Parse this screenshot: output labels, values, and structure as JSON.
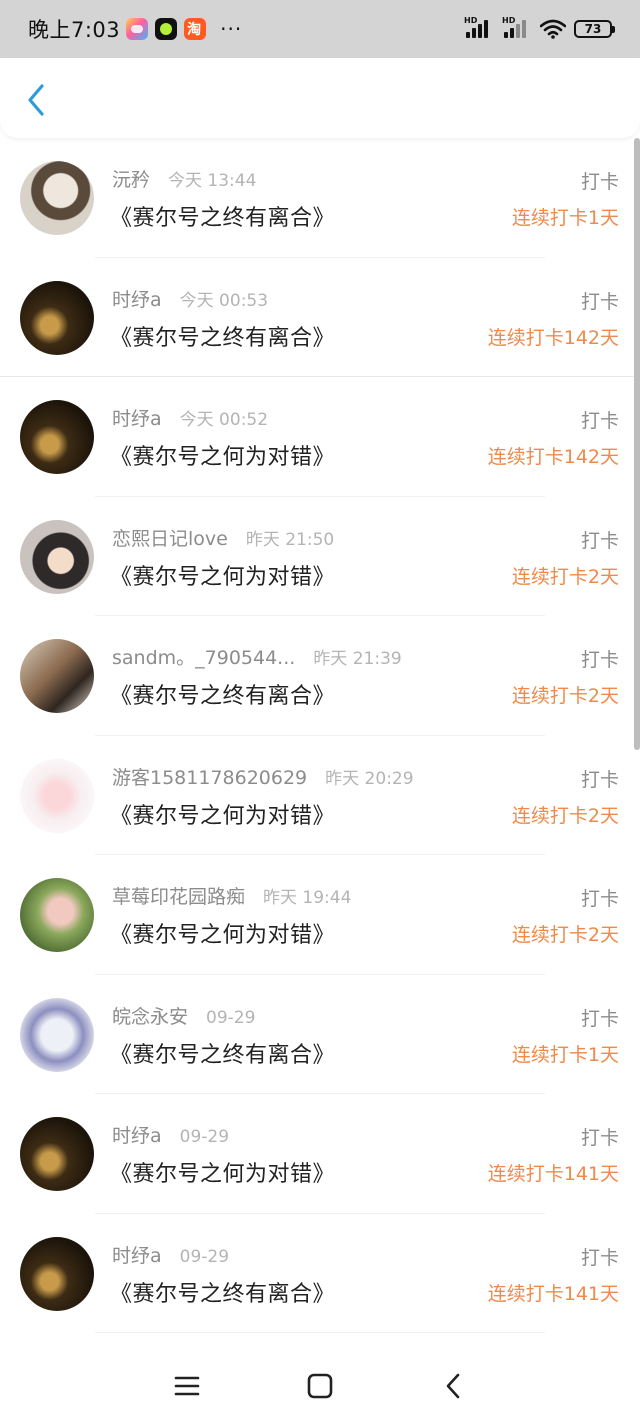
{
  "status_bar": {
    "time": "晚上7:03",
    "more": "···",
    "hd_label": "HD",
    "battery": "73",
    "icons": [
      "game-app-icon",
      "green-dot-app-icon",
      "taobao-app-icon",
      "signal-icon",
      "wifi-icon",
      "battery-icon"
    ]
  },
  "header": {
    "back_icon": "chevron-left-icon",
    "accent_color": "#2d9cdb"
  },
  "list": {
    "items": [
      {
        "user": "沅矜",
        "time": "今天 13:44",
        "title": "《赛尔号之终有离合》",
        "tag": "打卡",
        "streak": "连续打卡1天",
        "avatar": "anime-girl-avatar"
      },
      {
        "user": "时纾a",
        "time": "今天 00:53",
        "title": "《赛尔号之终有离合》",
        "tag": "打卡",
        "streak": "连续打卡142天",
        "avatar": "dark-photo-avatar"
      },
      {
        "user": "时纾a",
        "time": "今天 00:52",
        "title": "《赛尔号之何为对错》",
        "tag": "打卡",
        "streak": "连续打卡142天",
        "avatar": "dark-photo-avatar"
      },
      {
        "user": "恋熙日记love",
        "time": "昨天 21:50",
        "title": "《赛尔号之何为对错》",
        "tag": "打卡",
        "streak": "连续打卡2天",
        "avatar": "anime-boy-avatar"
      },
      {
        "user": "sandm。_790544...",
        "time": "昨天 21:39",
        "title": "《赛尔号之终有离合》",
        "tag": "打卡",
        "streak": "连续打卡2天",
        "avatar": "room-photo-avatar"
      },
      {
        "user": "游客1581178620629",
        "time": "昨天 20:29",
        "title": "《赛尔号之何为对错》",
        "tag": "打卡",
        "streak": "连续打卡2天",
        "avatar": "pink-anime-avatar"
      },
      {
        "user": "草莓印花园路痴",
        "time": "昨天 19:44",
        "title": "《赛尔号之何为对错》",
        "tag": "打卡",
        "streak": "连续打卡2天",
        "avatar": "girl-photo-avatar"
      },
      {
        "user": "皖念永安",
        "time": "09-29",
        "title": "《赛尔号之终有离合》",
        "tag": "打卡",
        "streak": "连续打卡1天",
        "avatar": "sketch-avatar"
      },
      {
        "user": "时纾a",
        "time": "09-29",
        "title": "《赛尔号之何为对错》",
        "tag": "打卡",
        "streak": "连续打卡141天",
        "avatar": "dark-photo-avatar"
      },
      {
        "user": "时纾a",
        "time": "09-29",
        "title": "《赛尔号之终有离合》",
        "tag": "打卡",
        "streak": "连续打卡141天",
        "avatar": "dark-photo-avatar"
      }
    ],
    "streak_color": "#f08a4b"
  },
  "nav_bar": {
    "icons": [
      "menu-icon",
      "home-icon",
      "back-icon"
    ]
  }
}
